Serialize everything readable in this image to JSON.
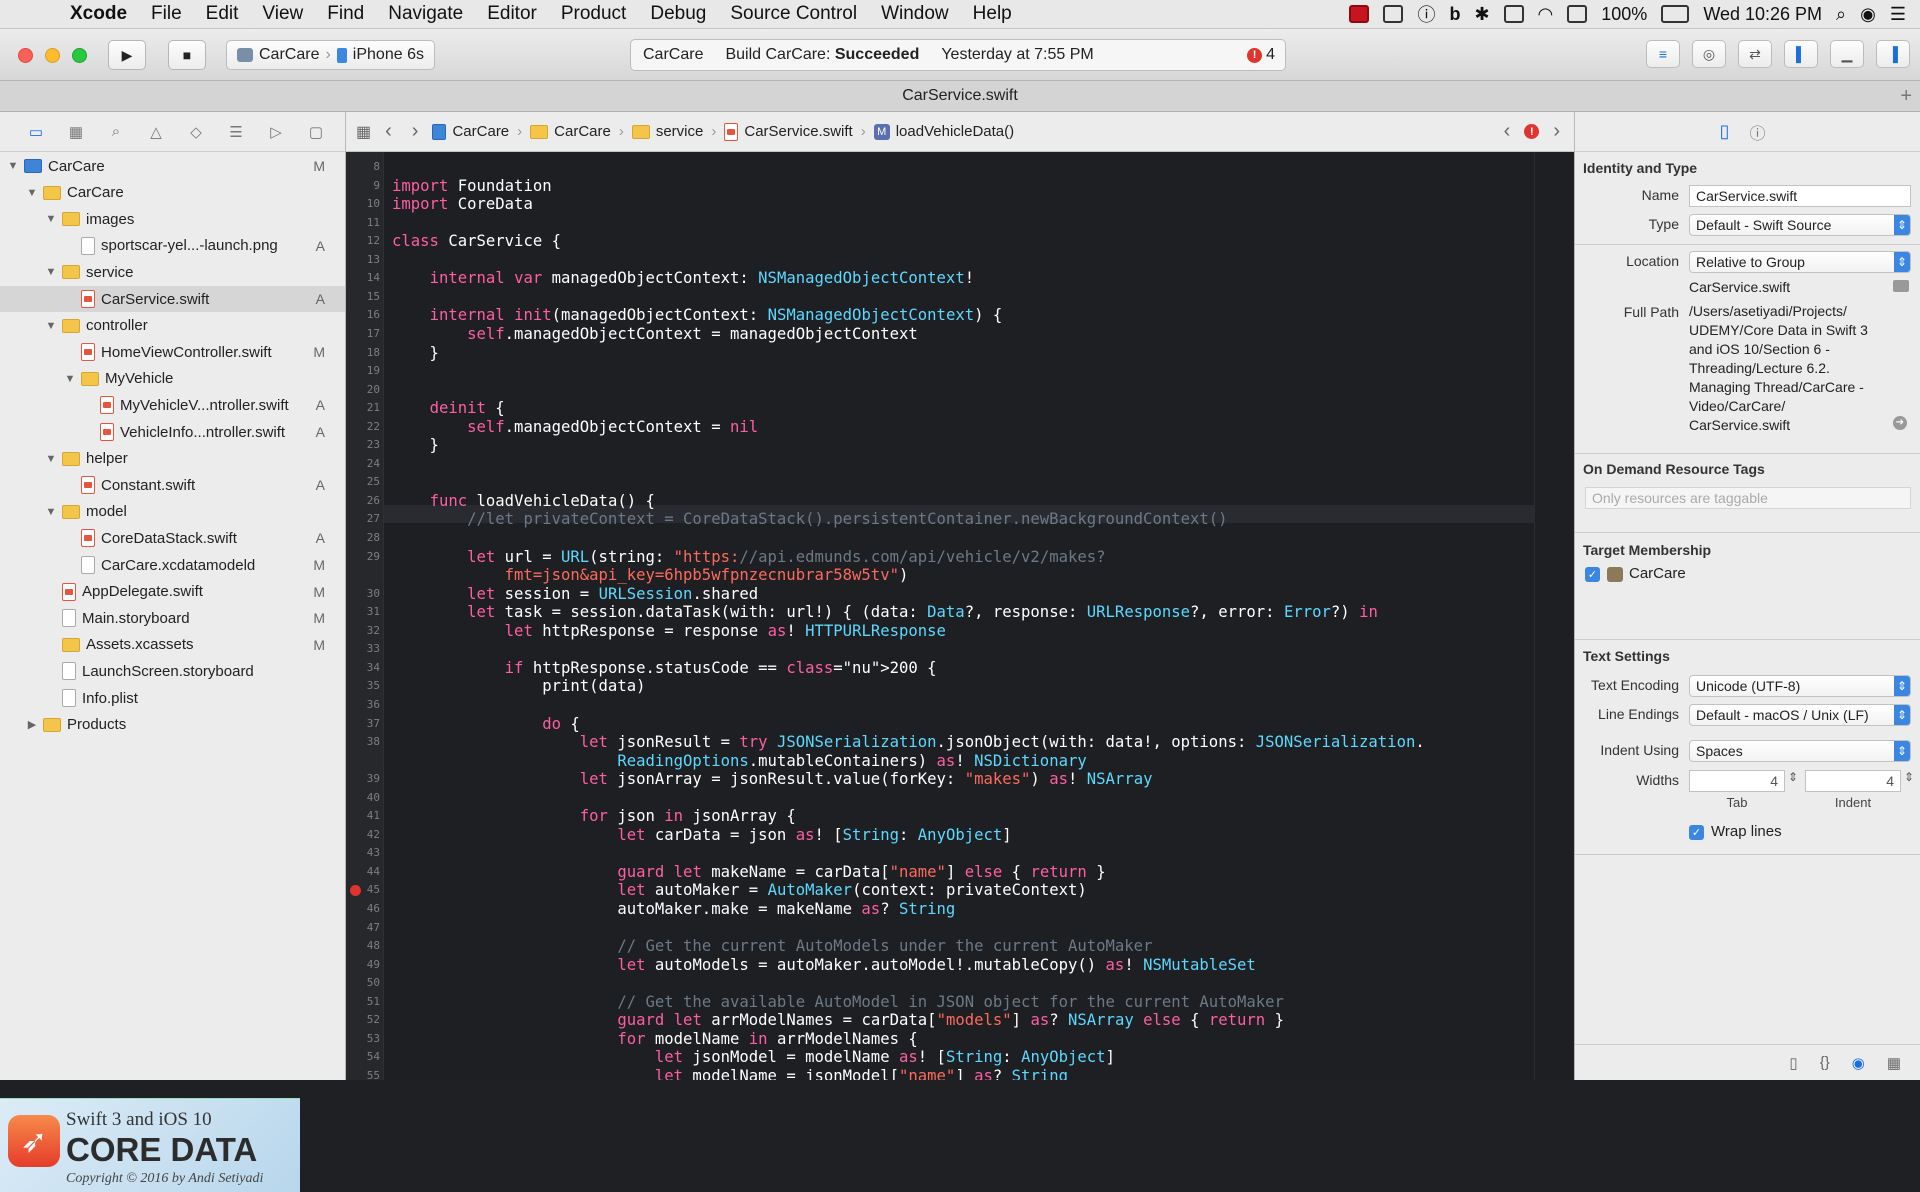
{
  "menubar": {
    "items": [
      "Xcode",
      "File",
      "Edit",
      "View",
      "Find",
      "Navigate",
      "Editor",
      "Product",
      "Debug",
      "Source Control",
      "Window",
      "Help"
    ],
    "battery": "100%",
    "datetime": "Wed 10:26 PM"
  },
  "toolbar": {
    "scheme": "CarCare",
    "device": "iPhone 6s",
    "activity_project": "CarCare",
    "build_prefix": "Build CarCare:",
    "build_status": "Succeeded",
    "build_time": "Yesterday at 7:55 PM",
    "error_count": "4"
  },
  "tab": {
    "title": "CarService.swift"
  },
  "navigator": {
    "rows": [
      {
        "label": "CarCare",
        "badge": "M"
      },
      {
        "label": "CarCare",
        "badge": ""
      },
      {
        "label": "images",
        "badge": ""
      },
      {
        "label": "sportscar-yel...-launch.png",
        "badge": "A"
      },
      {
        "label": "service",
        "badge": ""
      },
      {
        "label": "CarService.swift",
        "badge": "A"
      },
      {
        "label": "controller",
        "badge": ""
      },
      {
        "label": "HomeViewController.swift",
        "badge": "M"
      },
      {
        "label": "MyVehicle",
        "badge": ""
      },
      {
        "label": "MyVehicleV...ntroller.swift",
        "badge": "A"
      },
      {
        "label": "VehicleInfo...ntroller.swift",
        "badge": "A"
      },
      {
        "label": "helper",
        "badge": ""
      },
      {
        "label": "Constant.swift",
        "badge": "A"
      },
      {
        "label": "model",
        "badge": ""
      },
      {
        "label": "CoreDataStack.swift",
        "badge": "A"
      },
      {
        "label": "CarCare.xcdatamodeld",
        "badge": "M"
      },
      {
        "label": "AppDelegate.swift",
        "badge": "M"
      },
      {
        "label": "Main.storyboard",
        "badge": "M"
      },
      {
        "label": "Assets.xcassets",
        "badge": "M"
      },
      {
        "label": "LaunchScreen.storyboard",
        "badge": ""
      },
      {
        "label": "Info.plist",
        "badge": ""
      },
      {
        "label": "Products",
        "badge": ""
      }
    ]
  },
  "watermark": {
    "line1": "Swift 3 and iOS 10",
    "line2": "CORE DATA",
    "line3": "Copyright © 2016 by Andi Setiyadi"
  },
  "jumpbar": {
    "crumbs": [
      "CarCare",
      "CarCare",
      "service",
      "CarService.swift",
      "loadVehicleData()"
    ]
  },
  "code": {
    "line_numbers": [
      "8",
      "9",
      "10",
      "11",
      "12",
      "13",
      "14",
      "15",
      "16",
      "17",
      "18",
      "19",
      "20",
      "21",
      "22",
      "23",
      "24",
      "25",
      "26",
      "27",
      "28",
      "29",
      "",
      "30",
      "31",
      "32",
      "33",
      "34",
      "35",
      "36",
      "37",
      "38",
      "",
      "39",
      "40",
      "41",
      "42",
      "43",
      "44",
      "45",
      "46",
      "47",
      "48",
      "49",
      "50",
      "51",
      "52",
      "53",
      "54",
      "55"
    ],
    "lines": [
      "",
      "import Foundation",
      "import CoreData",
      "",
      "class CarService {",
      "",
      "    internal var managedObjectContext: NSManagedObjectContext!",
      "",
      "    internal init(managedObjectContext: NSManagedObjectContext) {",
      "        self.managedObjectContext = managedObjectContext",
      "    }",
      "",
      "",
      "    deinit {",
      "        self.managedObjectContext = nil",
      "    }",
      "",
      "",
      "    func loadVehicleData() {",
      "        //let privateContext = CoreDataStack().persistentContainer.newBackgroundContext()",
      "",
      "        let url = URL(string: \"https://api.edmunds.com/api/vehicle/v2/makes?",
      "            fmt=json&api_key=6hpb5wfpnzecnubrar58w5tv\")",
      "        let session = URLSession.shared",
      "        let task = session.dataTask(with: url!) { (data: Data?, response: URLResponse?, error: Error?) in",
      "            let httpResponse = response as! HTTPURLResponse",
      "",
      "            if httpResponse.statusCode == 200 {",
      "                print(data)",
      "",
      "                do {",
      "                    let jsonResult = try JSONSerialization.jsonObject(with: data!, options: JSONSerialization.",
      "                        ReadingOptions.mutableContainers) as! NSDictionary",
      "                    let jsonArray = jsonResult.value(forKey: \"makes\") as! NSArray",
      "",
      "                    for json in jsonArray {",
      "                        let carData = json as! [String: AnyObject]",
      "",
      "                        guard let makeName = carData[\"name\"] else { return }",
      "                        let autoMaker = AutoMaker(context: privateContext)",
      "                        autoMaker.make = makeName as? String",
      "",
      "                        // Get the current AutoModels under the current AutoMaker",
      "                        let autoModels = autoMaker.autoModel!.mutableCopy() as! NSMutableSet",
      "",
      "                        // Get the available AutoModel in JSON object for the current AutoMaker",
      "                        guard let arrModelNames = carData[\"models\"] as? NSArray else { return }",
      "                        for modelName in arrModelNames {",
      "                            let jsonModel = modelName as! [String: AnyObject]",
      "                            let modelName = jsonModel[\"name\"] as? String"
    ]
  },
  "inspector": {
    "identity_header": "Identity and Type",
    "name_label": "Name",
    "name_value": "CarService.swift",
    "type_label": "Type",
    "type_value": "Default - Swift Source",
    "location_label": "Location",
    "location_value": "Relative to Group",
    "location_file": "CarService.swift",
    "fullpath_label": "Full Path",
    "fullpath_lines": [
      "/Users/asetiyadi/Projects/",
      "UDEMY/Core Data in Swift 3",
      "and iOS 10/Section 6 -",
      "Threading/Lecture 6.2.",
      "Managing Thread/CarCare -",
      "Video/CarCare/",
      "CarService.swift"
    ],
    "ondemand_header": "On Demand Resource Tags",
    "ondemand_placeholder": "Only resources are taggable",
    "target_header": "Target Membership",
    "target_name": "CarCare",
    "text_header": "Text Settings",
    "encoding_label": "Text Encoding",
    "encoding_value": "Unicode (UTF-8)",
    "endings_label": "Line Endings",
    "endings_value": "Default - macOS / Unix (LF)",
    "indent_label": "Indent Using",
    "indent_value": "Spaces",
    "widths_label": "Widths",
    "tab_value": "4",
    "indent_width_value": "4",
    "tab_caption": "Tab",
    "indent_caption": "Indent",
    "wrap_label": "Wrap lines"
  }
}
